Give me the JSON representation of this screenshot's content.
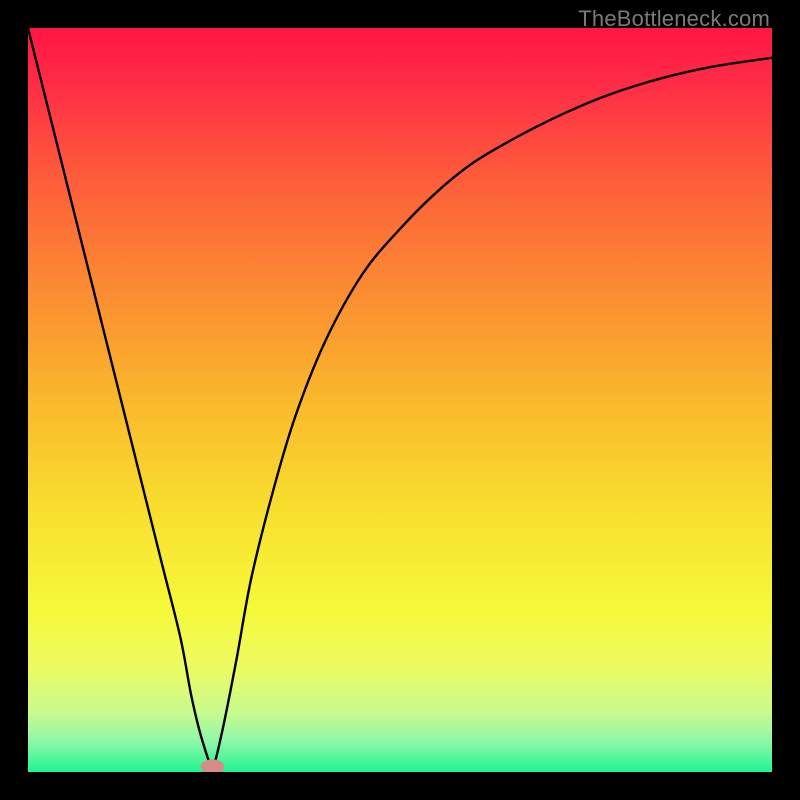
{
  "watermark": "TheBottleneck.com",
  "chart_data": {
    "type": "line",
    "title": "",
    "xlabel": "",
    "ylabel": "",
    "xlim": [
      0,
      100
    ],
    "ylim": [
      0,
      100
    ],
    "grid": false,
    "legend": false,
    "background": {
      "type": "vertical-gradient",
      "stops": [
        {
          "pos": 0.0,
          "color": "#ff1744"
        },
        {
          "pos": 0.07,
          "color": "#ff2a46"
        },
        {
          "pos": 0.2,
          "color": "#fd5c3b"
        },
        {
          "pos": 0.35,
          "color": "#fb8b32"
        },
        {
          "pos": 0.5,
          "color": "#fab82c"
        },
        {
          "pos": 0.65,
          "color": "#f8df2f"
        },
        {
          "pos": 0.78,
          "color": "#f6f939"
        },
        {
          "pos": 0.86,
          "color": "#ecfb63"
        },
        {
          "pos": 0.92,
          "color": "#c8fa8e"
        },
        {
          "pos": 0.96,
          "color": "#8df7a8"
        },
        {
          "pos": 1.0,
          "color": "#1ef591"
        }
      ]
    },
    "series": [
      {
        "name": "curve",
        "stroke": "#000000",
        "stroke_width": 2.4,
        "x": [
          0,
          3,
          6,
          9,
          12,
          15,
          18,
          20.5,
          22,
          23.5,
          24.8,
          26,
          28,
          30,
          33,
          36,
          40,
          45,
          50,
          55,
          60,
          66,
          72,
          78,
          85,
          92,
          100
        ],
        "y": [
          100,
          88,
          76,
          64,
          52,
          40,
          28,
          18,
          10,
          4,
          1,
          5,
          15,
          26,
          38,
          48,
          58,
          67,
          73,
          78,
          82,
          85.5,
          88.5,
          91,
          93.2,
          94.8,
          96
        ]
      }
    ],
    "marker": {
      "name": "min-point",
      "x": 24.8,
      "y": 0.7,
      "rx": 1.6,
      "ry": 1.0,
      "color": "#d98b86"
    }
  }
}
